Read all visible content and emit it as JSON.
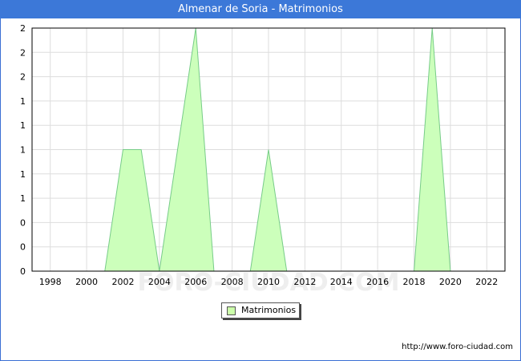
{
  "title": "Almenar de Soria - Matrimonios",
  "source_url": "http://www.foro-ciudad.com",
  "watermark": "FORO-CIUDAD.COM",
  "colors": {
    "title_bg": "#3c78d8",
    "fill": "#ccffbb",
    "line": "#77cc88",
    "grid": "#dddddd"
  },
  "chart_data": {
    "type": "area",
    "title": "Almenar de Soria - Matrimonios",
    "x": [
      1997,
      1998,
      1999,
      2000,
      2001,
      2002,
      2003,
      2004,
      2005,
      2006,
      2007,
      2008,
      2009,
      2010,
      2011,
      2012,
      2013,
      2014,
      2015,
      2016,
      2017,
      2018,
      2019,
      2020,
      2021,
      2022,
      2023
    ],
    "series": [
      {
        "name": "Matrimonios",
        "values": [
          0,
          0,
          0,
          0,
          0,
          1,
          1,
          0,
          1,
          2,
          0,
          0,
          0,
          1,
          0,
          0,
          0,
          0,
          0,
          0,
          0,
          0,
          2,
          0,
          0,
          0,
          0
        ]
      }
    ],
    "xticks": [
      "1998",
      "2000",
      "2002",
      "2004",
      "2006",
      "2008",
      "2010",
      "2012",
      "2014",
      "2016",
      "2018",
      "2020",
      "2022"
    ],
    "yticks": [
      "0",
      "0",
      "0",
      "1",
      "1",
      "1",
      "1",
      "1",
      "2",
      "2",
      "2"
    ],
    "ylim": [
      0,
      2
    ],
    "grid": true,
    "legend": "bottom-center"
  }
}
